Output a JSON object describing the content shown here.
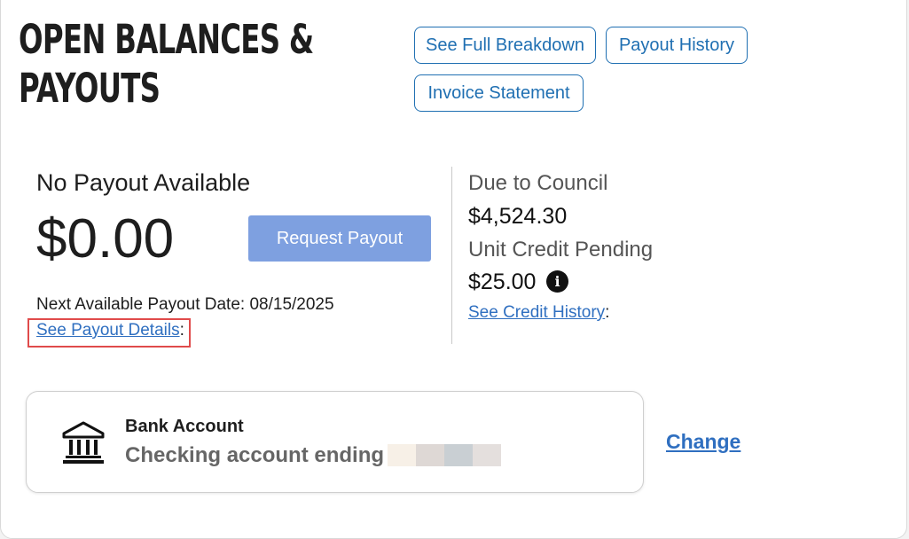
{
  "header": {
    "title_line1": "OPEN BALANCES &",
    "title_line2": "PAYOUTS",
    "buttons": {
      "full_breakdown": "See Full Breakdown",
      "payout_history": "Payout History",
      "invoice_statement": "Invoice Statement"
    }
  },
  "payout": {
    "status_title": "No Payout Available",
    "amount": "$0.00",
    "request_label": "Request Payout",
    "next_date_label": "Next Available Payout Date: ",
    "next_date_value": "08/15/2025",
    "details_link": "See Payout Details",
    "details_suffix": ":"
  },
  "council": {
    "due_label": "Due to Council",
    "due_value": "$4,524.30",
    "credit_label": "Unit Credit Pending",
    "credit_value": "$25.00",
    "credit_info_icon": "info-icon",
    "credit_history_link": "See Credit History",
    "credit_history_suffix": ":"
  },
  "bank": {
    "title": "Bank Account",
    "description": "Checking account ending in",
    "change_label": "Change",
    "icon": "bank-icon",
    "masked_colors": [
      "#f7f0e7",
      "#ded8d5",
      "#c9cfd3",
      "#e4dfdd"
    ]
  },
  "colors": {
    "accent": "#1f6fb2",
    "link": "#2f6fc0",
    "request_button": "#7ea0e0",
    "highlight": "#e04b4b"
  }
}
